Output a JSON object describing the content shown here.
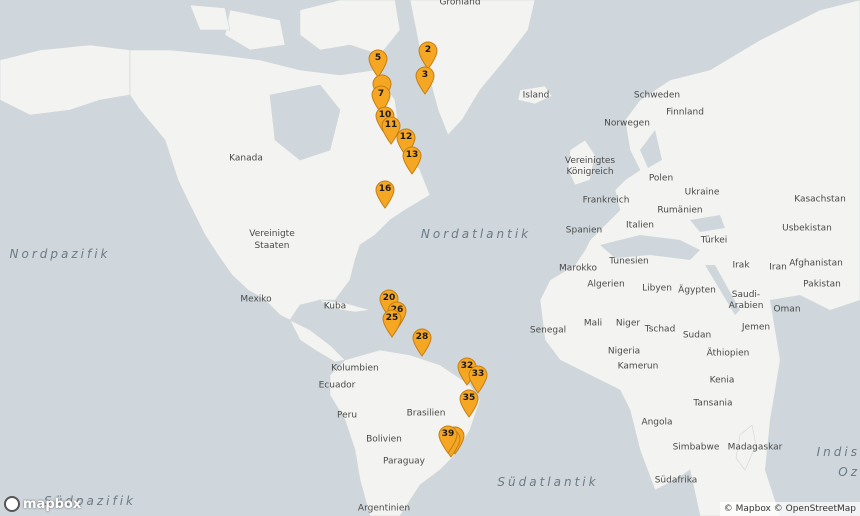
{
  "map": {
    "countries": [
      {
        "name": "Grönland"
      },
      {
        "name": "Kanada"
      },
      {
        "name": "Vereinigte Staaten"
      },
      {
        "name": "Mexiko"
      },
      {
        "name": "Kuba"
      },
      {
        "name": "Kolumbien"
      },
      {
        "name": "Ecuador"
      },
      {
        "name": "Peru"
      },
      {
        "name": "Bolivien"
      },
      {
        "name": "Paraguay"
      },
      {
        "name": "Argentinien"
      },
      {
        "name": "Brasilien"
      },
      {
        "name": "Island"
      },
      {
        "name": "Norwegen"
      },
      {
        "name": "Schweden"
      },
      {
        "name": "Finnland"
      },
      {
        "name": "Vereinigtes Königreich"
      },
      {
        "name": "Frankreich"
      },
      {
        "name": "Spanien"
      },
      {
        "name": "Italien"
      },
      {
        "name": "Polen"
      },
      {
        "name": "Ukraine"
      },
      {
        "name": "Rumänien"
      },
      {
        "name": "Türkei"
      },
      {
        "name": "Kasachstan"
      },
      {
        "name": "Usbekistan"
      },
      {
        "name": "Afghanistan"
      },
      {
        "name": "Iran"
      },
      {
        "name": "Irak"
      },
      {
        "name": "Pakistan"
      },
      {
        "name": "Saudi-Arabien"
      },
      {
        "name": "Oman"
      },
      {
        "name": "Jemen"
      },
      {
        "name": "Marokko"
      },
      {
        "name": "Tunesien"
      },
      {
        "name": "Algerien"
      },
      {
        "name": "Libyen"
      },
      {
        "name": "Ägypten"
      },
      {
        "name": "Senegal"
      },
      {
        "name": "Mali"
      },
      {
        "name": "Niger"
      },
      {
        "name": "Tschad"
      },
      {
        "name": "Sudan"
      },
      {
        "name": "Nigeria"
      },
      {
        "name": "Äthiopien"
      },
      {
        "name": "Kamerun"
      },
      {
        "name": "Kenia"
      },
      {
        "name": "Tansania"
      },
      {
        "name": "Angola"
      },
      {
        "name": "Simbabwe"
      },
      {
        "name": "Madagaskar"
      },
      {
        "name": "Südafrika"
      }
    ],
    "oceans": [
      {
        "name": "Nordpazifik"
      },
      {
        "name": "Nordatlantik"
      },
      {
        "name": "Südatlantik"
      },
      {
        "name": "Südpazifik"
      },
      {
        "name": "Indis"
      },
      {
        "name": "Oz"
      }
    ],
    "markers": [
      {
        "label": "2"
      },
      {
        "label": "3"
      },
      {
        "label": "5"
      },
      {
        "label": ""
      },
      {
        "label": "7"
      },
      {
        "label": "10"
      },
      {
        "label": "11"
      },
      {
        "label": "12"
      },
      {
        "label": "13"
      },
      {
        "label": "16"
      },
      {
        "label": "20"
      },
      {
        "label": "26"
      },
      {
        "label": "25"
      },
      {
        "label": "28"
      },
      {
        "label": "32"
      },
      {
        "label": "33"
      },
      {
        "label": "35"
      },
      {
        "label": ""
      },
      {
        "label": ""
      },
      {
        "label": "39"
      }
    ],
    "marker_color": "#f5a623",
    "land_color": "#f3f3f1",
    "water_color": "#cfd7dc"
  },
  "attribution": "© Mapbox © OpenStreetMap",
  "logo_text": "mapbox"
}
